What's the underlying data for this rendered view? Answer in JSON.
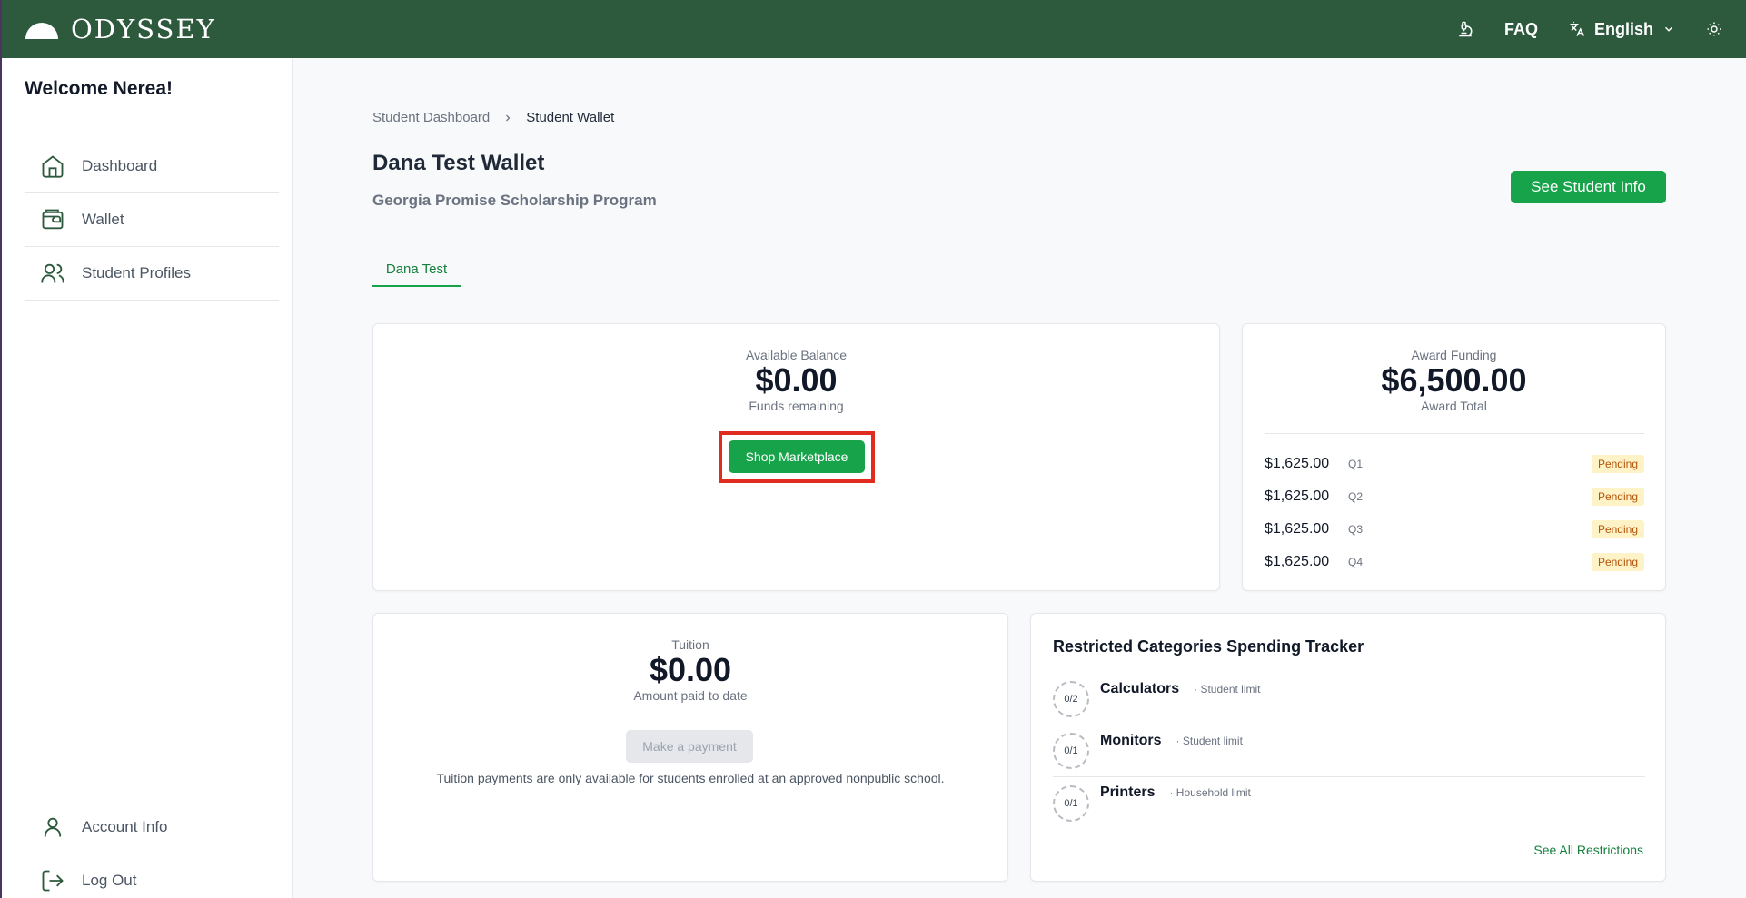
{
  "header": {
    "brand": "ODYSSEY",
    "faq": "FAQ",
    "language": "English"
  },
  "sidebar": {
    "welcome": "Welcome Nerea!",
    "items": [
      {
        "label": "Dashboard",
        "icon": "home-icon"
      },
      {
        "label": "Wallet",
        "icon": "wallet-icon"
      },
      {
        "label": "Student Profiles",
        "icon": "users-icon"
      }
    ],
    "bottom_items": [
      {
        "label": "Account Info",
        "icon": "user-icon"
      },
      {
        "label": "Log Out",
        "icon": "logout-icon"
      }
    ]
  },
  "breadcrumb": {
    "parent": "Student Dashboard",
    "current": "Student Wallet"
  },
  "page": {
    "title": "Dana Test Wallet",
    "program": "Georgia Promise Scholarship Program",
    "see_student_info": "See Student Info",
    "tab": "Dana Test"
  },
  "balance": {
    "label": "Available Balance",
    "amount": "$0.00",
    "sublabel": "Funds remaining",
    "button": "Shop Marketplace"
  },
  "award": {
    "label": "Award Funding",
    "amount": "$6,500.00",
    "sublabel": "Award Total",
    "quarters": [
      {
        "amount": "$1,625.00",
        "quarter": "Q1",
        "status": "Pending"
      },
      {
        "amount": "$1,625.00",
        "quarter": "Q2",
        "status": "Pending"
      },
      {
        "amount": "$1,625.00",
        "quarter": "Q3",
        "status": "Pending"
      },
      {
        "amount": "$1,625.00",
        "quarter": "Q4",
        "status": "Pending"
      }
    ]
  },
  "tuition": {
    "label": "Tuition",
    "amount": "$0.00",
    "sublabel": "Amount paid to date",
    "button": "Make a payment",
    "note": "Tuition payments are only available for students enrolled at an approved nonpublic school."
  },
  "restrictions": {
    "title": "Restricted Categories Spending Tracker",
    "items": [
      {
        "count": "0/2",
        "name": "Calculators",
        "limit": "· Student limit"
      },
      {
        "count": "0/1",
        "name": "Monitors",
        "limit": "· Student limit"
      },
      {
        "count": "0/1",
        "name": "Printers",
        "limit": "· Household limit"
      }
    ],
    "see_all": "See All Restrictions"
  },
  "colors": {
    "header_bg": "#2d5a3d",
    "primary_green": "#16a34a",
    "highlight_red": "#e02c1f",
    "pending_bg": "#fef3c7"
  }
}
